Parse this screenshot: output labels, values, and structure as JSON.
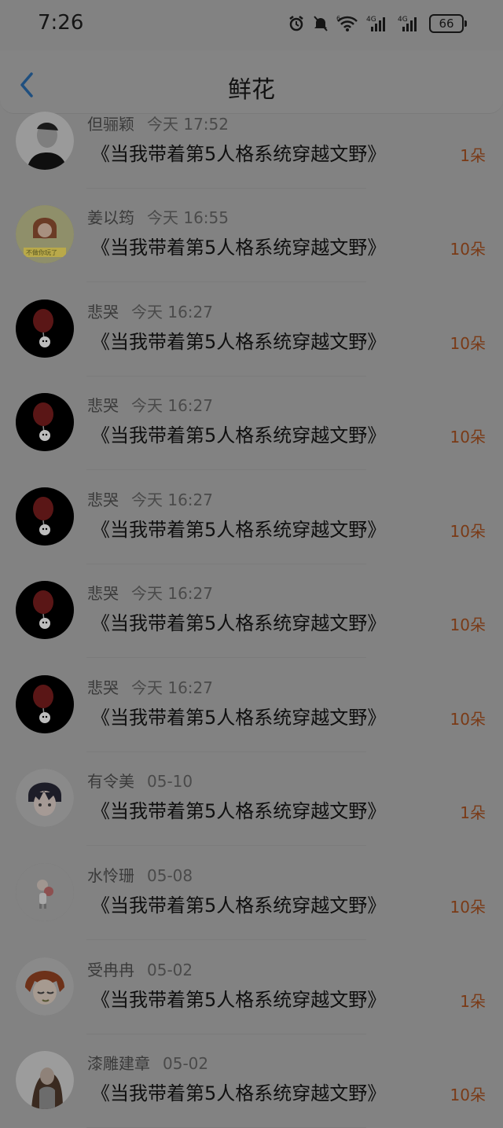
{
  "status_bar": {
    "time": "7:26",
    "battery": "66",
    "icons": [
      "alarm-icon",
      "mute-icon",
      "wifi-icon",
      "signal-4g-icon",
      "signal-4g-icon"
    ]
  },
  "header": {
    "title": "鲜花",
    "back_icon": "chevron-left-icon"
  },
  "flowers": [
    {
      "name": "但骊颖",
      "time": "今天 17:52",
      "book": "《当我带着第5人格系统穿越文野》",
      "amount": "1朵",
      "avatar": "man-portrait"
    },
    {
      "name": "姜以筠",
      "time": "今天 16:55",
      "book": "《当我带着第5人格系统穿越文野》",
      "amount": "10朵",
      "avatar": "girl-sticker"
    },
    {
      "name": "悲哭",
      "time": "今天 16:27",
      "book": "《当我带着第5人格系统穿越文野》",
      "amount": "10朵",
      "avatar": "red-balloon"
    },
    {
      "name": "悲哭",
      "time": "今天 16:27",
      "book": "《当我带着第5人格系统穿越文野》",
      "amount": "10朵",
      "avatar": "red-balloon"
    },
    {
      "name": "悲哭",
      "time": "今天 16:27",
      "book": "《当我带着第5人格系统穿越文野》",
      "amount": "10朵",
      "avatar": "red-balloon"
    },
    {
      "name": "悲哭",
      "time": "今天 16:27",
      "book": "《当我带着第5人格系统穿越文野》",
      "amount": "10朵",
      "avatar": "red-balloon"
    },
    {
      "name": "悲哭",
      "time": "今天 16:27",
      "book": "《当我带着第5人格系统穿越文野》",
      "amount": "10朵",
      "avatar": "red-balloon"
    },
    {
      "name": "有令美",
      "time": "05-10",
      "book": "《当我带着第5人格系统穿越文野》",
      "amount": "1朵",
      "avatar": "anime-boy"
    },
    {
      "name": "水怜珊",
      "time": "05-08",
      "book": "《当我带着第5人格系统穿越文野》",
      "amount": "10朵",
      "avatar": "small-figure"
    },
    {
      "name": "受冉冉",
      "time": "05-02",
      "book": "《当我带着第5人格系统穿越文野》",
      "amount": "1朵",
      "avatar": "anime-red-hair"
    },
    {
      "name": "漆雕建章",
      "time": "05-02",
      "book": "《当我带着第5人格系统穿越文野》",
      "amount": "10朵",
      "avatar": "photo-girl"
    }
  ],
  "colors": {
    "background": "#828282",
    "amount_color": "#7a3a16",
    "title_color": "#111111"
  }
}
